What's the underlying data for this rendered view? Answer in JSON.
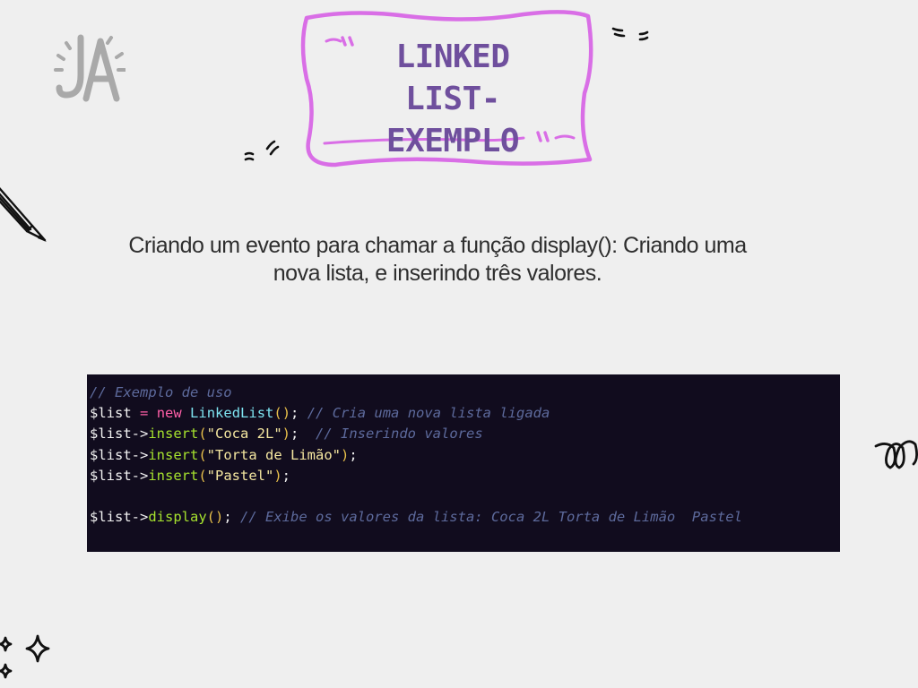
{
  "logo": {
    "icon": "ja-monogram-logo",
    "text": "JA"
  },
  "title": {
    "line1": "Linked List-",
    "line2": "Exemplo",
    "color": "#6f4f9d",
    "frame_color": "#d96ee6"
  },
  "subtitle": {
    "line1": "Criando um evento para chamar a função display(): Criando uma",
    "line2": "nova lista, e inserindo três valores."
  },
  "code": {
    "background": "#110c1e",
    "lines": [
      [
        {
          "t": "comment",
          "v": "// Exemplo de uso"
        }
      ],
      [
        {
          "t": "var",
          "v": "$list"
        },
        {
          "t": "plain",
          "v": " "
        },
        {
          "t": "op",
          "v": "="
        },
        {
          "t": "plain",
          "v": " "
        },
        {
          "t": "kw",
          "v": "new"
        },
        {
          "t": "plain",
          "v": " "
        },
        {
          "t": "class",
          "v": "LinkedList"
        },
        {
          "t": "paren",
          "v": "()"
        },
        {
          "t": "plain",
          "v": "; "
        },
        {
          "t": "comment",
          "v": "// Cria uma nova lista ligada"
        }
      ],
      [
        {
          "t": "var",
          "v": "$list->"
        },
        {
          "t": "method",
          "v": "insert"
        },
        {
          "t": "paren",
          "v": "("
        },
        {
          "t": "str",
          "v": "\"Coca 2L\""
        },
        {
          "t": "paren",
          "v": ")"
        },
        {
          "t": "plain",
          "v": ";  "
        },
        {
          "t": "comment",
          "v": "// Inserindo valores"
        }
      ],
      [
        {
          "t": "var",
          "v": "$list->"
        },
        {
          "t": "method",
          "v": "insert"
        },
        {
          "t": "paren",
          "v": "("
        },
        {
          "t": "str",
          "v": "\"Torta de Limão\""
        },
        {
          "t": "paren",
          "v": ")"
        },
        {
          "t": "plain",
          "v": ";"
        }
      ],
      [
        {
          "t": "var",
          "v": "$list->"
        },
        {
          "t": "method",
          "v": "insert"
        },
        {
          "t": "paren",
          "v": "("
        },
        {
          "t": "str",
          "v": "\"Pastel\""
        },
        {
          "t": "paren",
          "v": ")"
        },
        {
          "t": "plain",
          "v": ";"
        }
      ],
      [],
      [
        {
          "t": "var",
          "v": "$list->"
        },
        {
          "t": "method",
          "v": "display"
        },
        {
          "t": "paren",
          "v": "()"
        },
        {
          "t": "plain",
          "v": "; "
        },
        {
          "t": "comment",
          "v": "// Exibe os valores da lista: Coca 2L Torta de Limão  Pastel"
        }
      ]
    ]
  },
  "decorations": {
    "pencil": "pencil-icon",
    "quotes": "quote-marks-icon",
    "curl": "curl-doodle-icon",
    "sparkles": "sparkle-stars-icon"
  }
}
